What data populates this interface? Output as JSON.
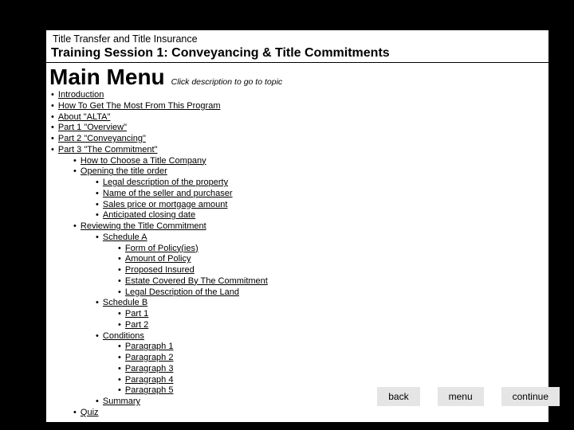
{
  "header": {
    "course_title": "Title Transfer and Title Insurance",
    "session_title": "Training Session 1: Conveyancing & Title Commitments",
    "main_menu_label": "Main Menu",
    "hint": "Click description to go to topic"
  },
  "topics": [
    {
      "level": 0,
      "label": "Introduction"
    },
    {
      "level": 0,
      "label": "How To Get The Most From This Program"
    },
    {
      "level": 0,
      "label": "About \"ALTA\""
    },
    {
      "level": 0,
      "label": "Part 1 \"Overview\""
    },
    {
      "level": 0,
      "label": "Part 2 \"Conveyancing\""
    },
    {
      "level": 0,
      "label": "Part 3 \"The Commitment\""
    },
    {
      "level": 1,
      "label": "How to Choose a Title Company"
    },
    {
      "level": 1,
      "label": "Opening the title order"
    },
    {
      "level": 2,
      "label": "Legal description of the property"
    },
    {
      "level": 2,
      "label": "Name of the seller and purchaser"
    },
    {
      "level": 2,
      "label": "Sales price or mortgage amount"
    },
    {
      "level": 2,
      "label": "Anticipated closing date"
    },
    {
      "level": 1,
      "label": "Reviewing the Title Commitment"
    },
    {
      "level": 2,
      "label": "Schedule A"
    },
    {
      "level": 3,
      "label": "Form of Policy(ies)"
    },
    {
      "level": 3,
      "label": "Amount of Policy"
    },
    {
      "level": 3,
      "label": "Proposed Insured"
    },
    {
      "level": 3,
      "label": "Estate Covered By The Commitment"
    },
    {
      "level": 3,
      "label": "Legal Description of the Land"
    },
    {
      "level": 2,
      "label": "Schedule B"
    },
    {
      "level": 3,
      "label": "Part 1"
    },
    {
      "level": 3,
      "label": "Part 2"
    },
    {
      "level": 2,
      "label": "Conditions"
    },
    {
      "level": 3,
      "label": "Paragraph 1"
    },
    {
      "level": 3,
      "label": "Paragraph 2"
    },
    {
      "level": 3,
      "label": "Paragraph 3"
    },
    {
      "level": 3,
      "label": "Paragraph 4"
    },
    {
      "level": 3,
      "label": "Paragraph 5"
    },
    {
      "level": 2,
      "label": "Summary"
    },
    {
      "level": 1,
      "label": "Quiz"
    }
  ],
  "nav": {
    "back": "back",
    "menu": "menu",
    "continue": "continue"
  }
}
